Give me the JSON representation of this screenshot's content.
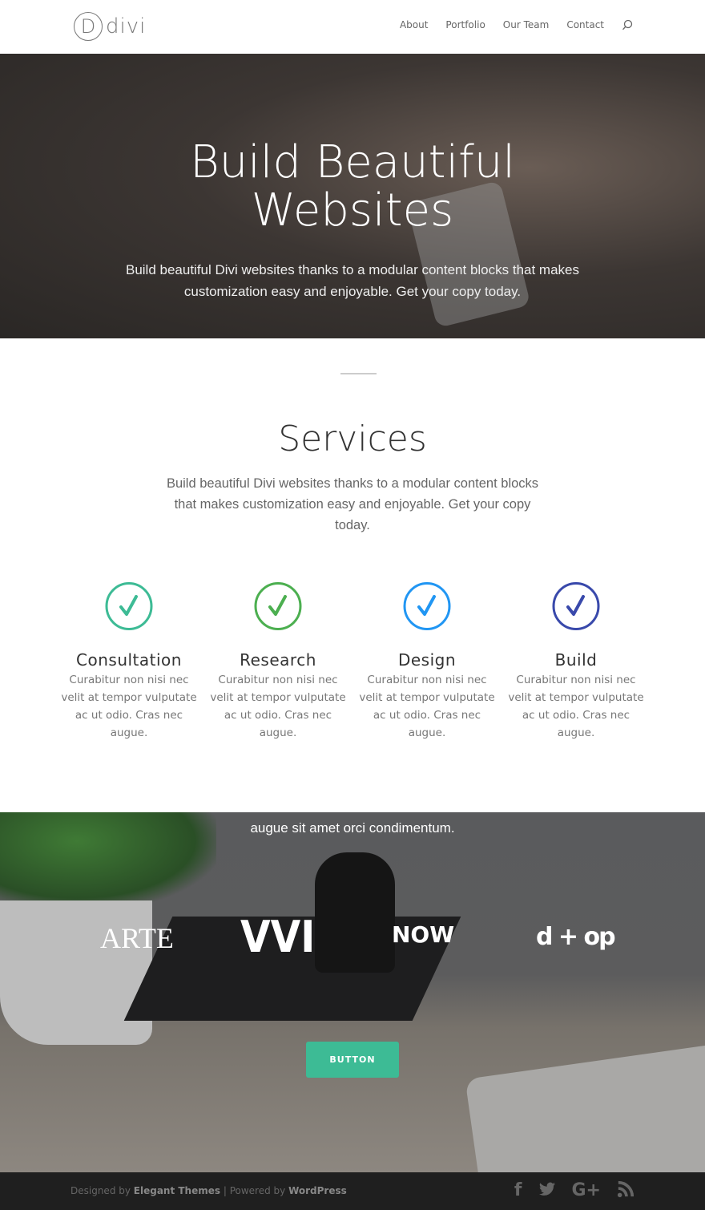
{
  "header": {
    "logo_letter": "D",
    "logo_text": "divi",
    "nav": [
      "About",
      "Portfolio",
      "Our Team",
      "Contact"
    ]
  },
  "hero": {
    "title_line1": "Build Beautiful",
    "title_line2": "Websites",
    "text": "Build beautiful Divi websites thanks to a modular content blocks that makes customization easy and enjoyable. Get your copy today."
  },
  "services": {
    "title": "Services",
    "desc": "Build beautiful Divi websites thanks to a modular content blocks that makes customization easy and enjoyable. Get your copy today.",
    "items": [
      {
        "title": "Consultation",
        "text": "Curabitur non nisi nec velit at tempor vulputate ac ut odio. Cras nec augue.",
        "color": "#3dbb95",
        "icon": "check-circle-icon"
      },
      {
        "title": "Research",
        "text": "Curabitur non nisi nec velit at tempor vulputate ac ut odio. Cras nec augue.",
        "color": "#4caf50",
        "icon": "check-circle-icon"
      },
      {
        "title": "Design",
        "text": "Curabitur non nisi nec velit at tempor vulputate ac ut odio. Cras nec augue.",
        "color": "#2196f3",
        "icon": "check-circle-icon"
      },
      {
        "title": "Build",
        "text": "Curabitur non nisi nec velit at tempor vulputate ac ut odio. Cras nec augue.",
        "color": "#3949ab",
        "icon": "check-circle-icon"
      }
    ]
  },
  "clients": {
    "caption": "augue sit amet orci condimentum.",
    "logos": [
      "ARTE",
      "VVI",
      "NOW",
      "d + op"
    ],
    "button": "BUTTON",
    "button_color": "#3dbb95"
  },
  "footer": {
    "designed_by": "Designed by ",
    "elegant": "Elegant Themes",
    "sep": " | Powered by ",
    "wordpress": "WordPress",
    "social": [
      "facebook-icon",
      "twitter-icon",
      "google-plus-icon",
      "rss-icon"
    ]
  }
}
